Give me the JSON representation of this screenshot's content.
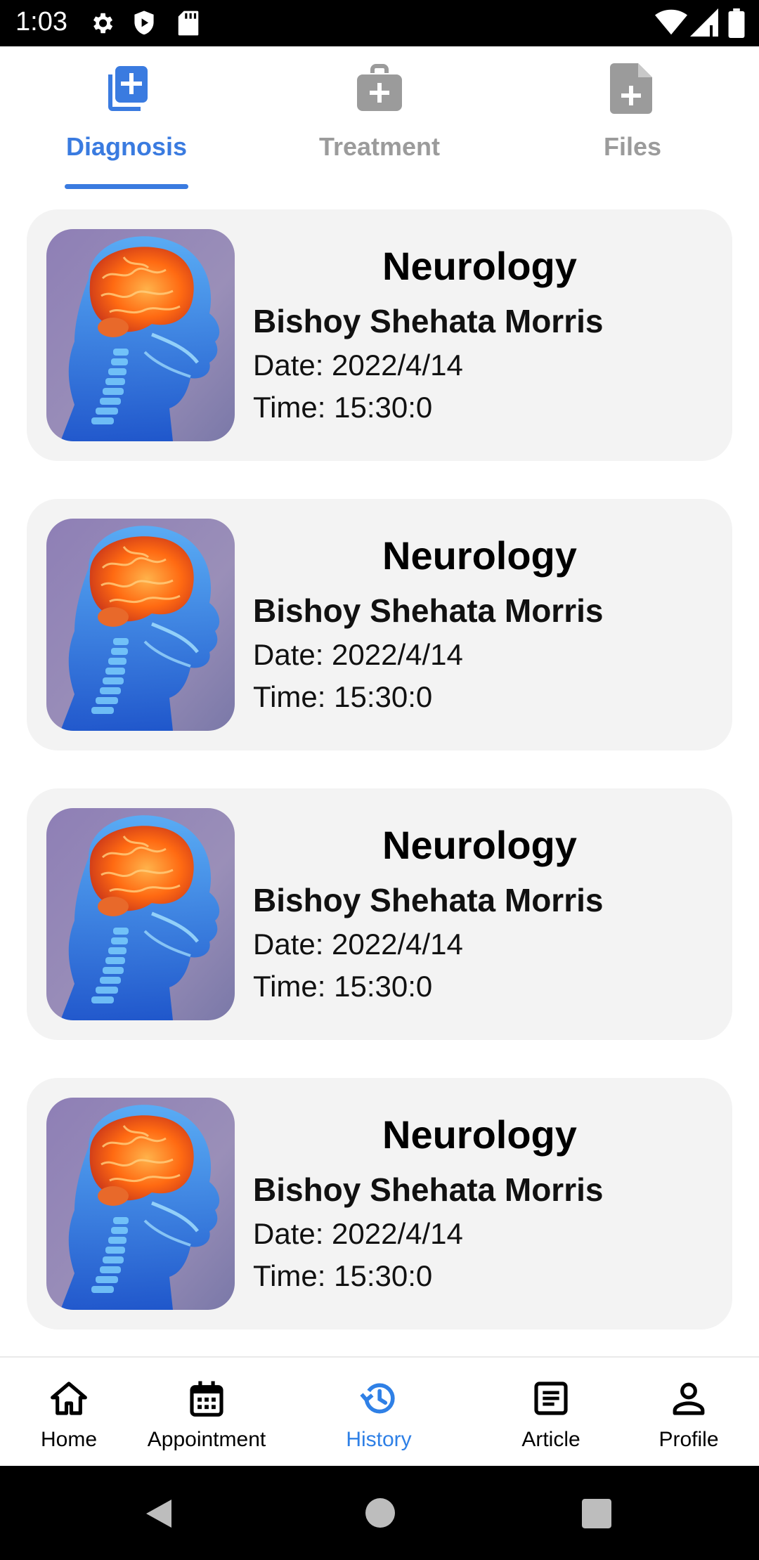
{
  "status_bar": {
    "time": "1:03"
  },
  "tabs": [
    {
      "label": "Diagnosis",
      "icon": "add-copy-icon",
      "active": true
    },
    {
      "label": "Treatment",
      "icon": "medical-briefcase-icon",
      "active": false
    },
    {
      "label": "Files",
      "icon": "file-plus-icon",
      "active": false
    }
  ],
  "cards": [
    {
      "title": "Neurology",
      "name": "Bishoy Shehata Morris",
      "date": "Date: 2022/4/14",
      "time": "Time: 15:30:0",
      "image": "brain-xray-image"
    },
    {
      "title": "Neurology",
      "name": "Bishoy Shehata Morris",
      "date": "Date: 2022/4/14",
      "time": "Time: 15:30:0",
      "image": "brain-xray-image"
    },
    {
      "title": "Neurology",
      "name": "Bishoy Shehata Morris",
      "date": "Date: 2022/4/14",
      "time": "Time: 15:30:0",
      "image": "brain-xray-image"
    },
    {
      "title": "Neurology",
      "name": "Bishoy Shehata Morris",
      "date": "Date: 2022/4/14",
      "time": "Time: 15:30:0",
      "image": "brain-xray-image"
    }
  ],
  "bottom_nav": [
    {
      "label": "Home",
      "icon": "home-icon",
      "active": false
    },
    {
      "label": "Appointment",
      "icon": "calendar-icon",
      "active": false
    },
    {
      "label": "History",
      "icon": "history-icon",
      "active": true
    },
    {
      "label": "Article",
      "icon": "article-icon",
      "active": false
    },
    {
      "label": "Profile",
      "icon": "person-icon",
      "active": false
    }
  ],
  "colors": {
    "accent": "#3a7be0",
    "inactive_tab": "#9b9b9b",
    "card_bg": "#f3f3f3",
    "nav_active": "#2f80e6"
  }
}
